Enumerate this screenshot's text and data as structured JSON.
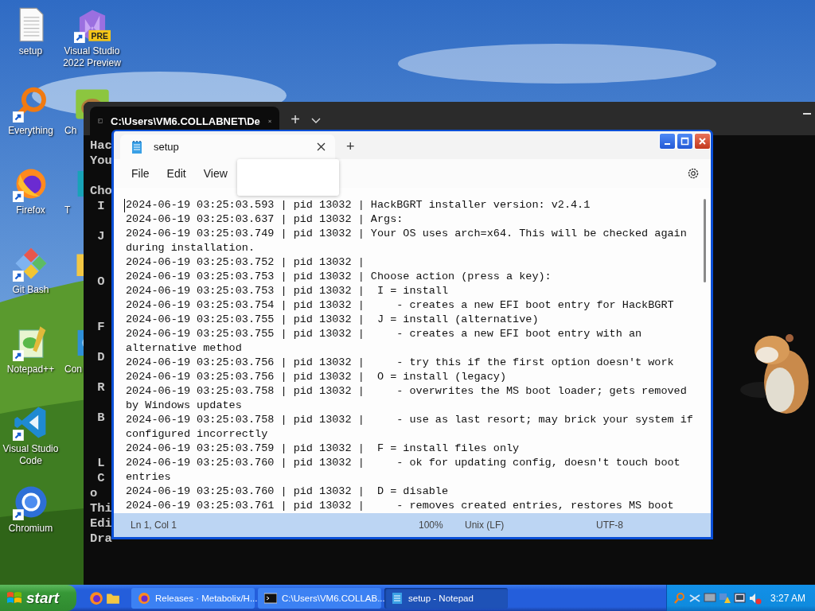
{
  "desktop_icons": [
    {
      "label": "setup",
      "kind": "document"
    },
    {
      "label": "Everything",
      "kind": "magnifier"
    },
    {
      "label": "Firefox",
      "kind": "fox"
    },
    {
      "label": "Git Bash",
      "kind": "diamond"
    },
    {
      "label": "Notepad++",
      "kind": "notepad"
    },
    {
      "label": "Visual Studio Code",
      "kind": "ribbon-blue"
    },
    {
      "label": "Chromium",
      "kind": "ring"
    }
  ],
  "desktop_icons_column_2": [
    {
      "label": "Visual Studio 2022 Preview",
      "kind": "ribbon-purple",
      "badge": "PRE"
    }
  ],
  "partly_hidden_icons": [
    {
      "label": "Ch",
      "kind": "hamster"
    },
    {
      "label": "T",
      "kind": "teal"
    },
    {
      "kind": "folder"
    },
    {
      "label": "Con",
      "kind": "panel"
    }
  ],
  "terminal": {
    "tab_title": "C:\\Users\\VM6.COLLABNET\\De",
    "new_tab": "+",
    "lines": [
      {
        "text": "Hac",
        "kind": "line"
      },
      {
        "text": "You",
        "kind": "line"
      },
      {
        "text": "Cho",
        "kind": "after_gap"
      },
      {
        "text": " I",
        "kind": "line"
      },
      {
        "text": " J",
        "kind": "after_gap"
      },
      {
        "text": " O",
        "kind": "after_wide_gap"
      },
      {
        "text": " F",
        "kind": "after_wide_gap"
      },
      {
        "text": " D",
        "kind": "after_gap"
      },
      {
        "text": " R",
        "kind": "after_gap"
      },
      {
        "text": " B",
        "kind": "after_gap"
      },
      {
        "text": " L",
        "kind": "after_wide_gap"
      },
      {
        "text": " C",
        "kind": "line"
      },
      {
        "text": "o",
        "kind": "line"
      },
      {
        "text": "Thi",
        "kind": "line"
      },
      {
        "text": "Edi",
        "kind": "line"
      },
      {
        "text": "Dra",
        "kind": "line"
      }
    ]
  },
  "notepad": {
    "tab_title": "setup",
    "new_tab": "+",
    "menu": [
      "File",
      "Edit",
      "View"
    ],
    "toast": {
      "kind": "popup"
    },
    "lines": [
      "2024-06-19 03:25:03.593 | pid 13032 | HackBGRT installer version: v2.4.1",
      "2024-06-19 03:25:03.637 | pid 13032 | Args:",
      "2024-06-19 03:25:03.749 | pid 13032 | Your OS uses arch=x64. This will be checked again during installation.",
      "2024-06-19 03:25:03.752 | pid 13032 |",
      "2024-06-19 03:25:03.753 | pid 13032 | Choose action (press a key):",
      "2024-06-19 03:25:03.753 | pid 13032 |  I = install",
      "2024-06-19 03:25:03.754 | pid 13032 |     - creates a new EFI boot entry for HackBGRT",
      "2024-06-19 03:25:03.755 | pid 13032 |  J = install (alternative)",
      "2024-06-19 03:25:03.755 | pid 13032 |     - creates a new EFI boot entry with an alternative method",
      "2024-06-19 03:25:03.756 | pid 13032 |     - try this if the first option doesn't work",
      "2024-06-19 03:25:03.756 | pid 13032 |  O = install (legacy)",
      "2024-06-19 03:25:03.758 | pid 13032 |     - overwrites the MS boot loader; gets removed by Windows updates",
      "2024-06-19 03:25:03.758 | pid 13032 |     - use as last resort; may brick your system if configured incorrectly",
      "2024-06-19 03:25:03.759 | pid 13032 |  F = install files only",
      "2024-06-19 03:25:03.760 | pid 13032 |     - ok for updating config, doesn't touch boot entries",
      "2024-06-19 03:25:03.760 | pid 13032 |  D = disable",
      "2024-06-19 03:25:03.761 | pid 13032 |     - removes created entries, restores MS boot"
    ],
    "status_bar": {
      "position": "Ln 1, Col 1",
      "zoom": "100%",
      "line_endings": "Unix (LF)",
      "encoding": "UTF-8"
    }
  },
  "taskbar": {
    "start": "start",
    "tasks": [
      {
        "label": "Releases · Metabolix/H...",
        "kind": "browser",
        "selected": false
      },
      {
        "label": "C:\\Users\\VM6.COLLAB...",
        "kind": "console",
        "selected": false
      },
      {
        "label": "setup - Notepad",
        "kind": "notepad",
        "selected": true
      }
    ],
    "clock": "3:27 AM"
  }
}
